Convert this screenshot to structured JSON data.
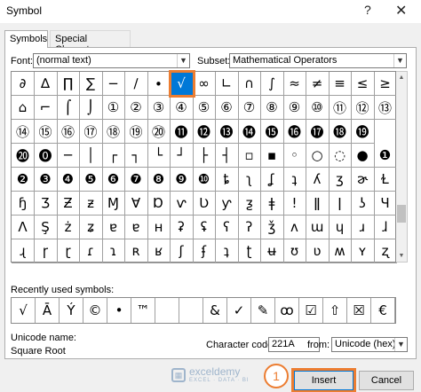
{
  "window": {
    "title": "Symbol",
    "help": "?",
    "close": "✕"
  },
  "tabs": [
    {
      "label": "Symbols"
    },
    {
      "label": "Special Characters"
    }
  ],
  "font": {
    "label": "Font:",
    "value": "(normal text)"
  },
  "subset": {
    "label": "Subset:",
    "value": "Mathematical Operators"
  },
  "grid_rows": [
    [
      "∂",
      "∆",
      "∏",
      "∑",
      "−",
      "∕",
      "∙",
      "√",
      "∞",
      "∟",
      "∩",
      "∫",
      "≈",
      "≠",
      "≡",
      "≤",
      "≥"
    ],
    [
      "⌂",
      "⌐",
      "⌠",
      "⌡",
      "①",
      "②",
      "③",
      "④",
      "⑤",
      "⑥",
      "⑦",
      "⑧",
      "⑨",
      "⑩",
      "⑪",
      "⑫",
      "⑬"
    ],
    [
      "⑭",
      "⑮",
      "⑯",
      "⑰",
      "⑱",
      "⑲",
      "⑳",
      "⓫",
      "⓬",
      "⓭",
      "⓮",
      "⓯",
      "⓰",
      "⓱",
      "⓲",
      "⓳"
    ],
    [
      "⓴",
      "⓿",
      "─",
      "│",
      "┌",
      "┐",
      "└",
      "┘",
      "├",
      "┤",
      "▫",
      "▪",
      "◦",
      "○",
      "◌",
      "●",
      "❶"
    ],
    [
      "❷",
      "❸",
      "❹",
      "❺",
      "❻",
      "❼",
      "❽",
      "❾",
      "❿",
      "ȶ",
      "ʅ",
      "ʆ",
      "ʇ",
      "ʎ",
      "ʒ",
      "ɚ",
      "Ɫ"
    ],
    [
      "ɧ",
      "Ʒ",
      "Ƶ",
      "ƶ",
      "Ɱ",
      "Ɐ",
      "Ɒ",
      "ⱱ",
      "Ʋ",
      "ƴ",
      "ƺ",
      "ǂ",
      "ǃ",
      "ǁ",
      "ǀ",
      "ʖ",
      "Ɥ"
    ],
    [
      "Ʌ",
      "Ş",
      "ż",
      "ʑ",
      "ɐ",
      "ɐ",
      "ʜ",
      "ʡ",
      "ʢ",
      "ʕ",
      "ʔ",
      "ǯ",
      "ʌ",
      "ɯ",
      "ɥ",
      "ɹ",
      "ɺ"
    ],
    [
      "ɻ",
      "ɼ",
      "ɽ",
      "ɾ",
      "ɿ",
      "ʀ",
      "ʁ",
      "ʃ",
      "ʄ",
      "ʇ",
      "ʈ",
      "ʉ",
      "ʊ",
      "ʋ",
      "ʍ",
      "ʏ",
      "ʐ"
    ]
  ],
  "selected_symbol": "√",
  "recent_label": "Recently used symbols:",
  "recent": [
    "√",
    "Ā",
    "Ý",
    "©",
    "•",
    "™",
    "",
    "",
    "&",
    "✓",
    "✎",
    "ꝏ",
    "☑",
    "⇧",
    "☒",
    "€"
  ],
  "unicode_name": {
    "label": "Unicode name:",
    "value": "Square Root"
  },
  "char_code": {
    "label": "Character code:",
    "value": "221A"
  },
  "from": {
    "label": "from:",
    "value": "Unicode (hex)"
  },
  "buttons": {
    "insert": "Insert",
    "cancel": "Cancel"
  },
  "callout": "1",
  "watermark": {
    "name": "exceldemy",
    "tagline": "EXCEL · DATA · BI"
  },
  "colors": {
    "accent": "#0078d7",
    "highlight": "#ec7d31"
  }
}
